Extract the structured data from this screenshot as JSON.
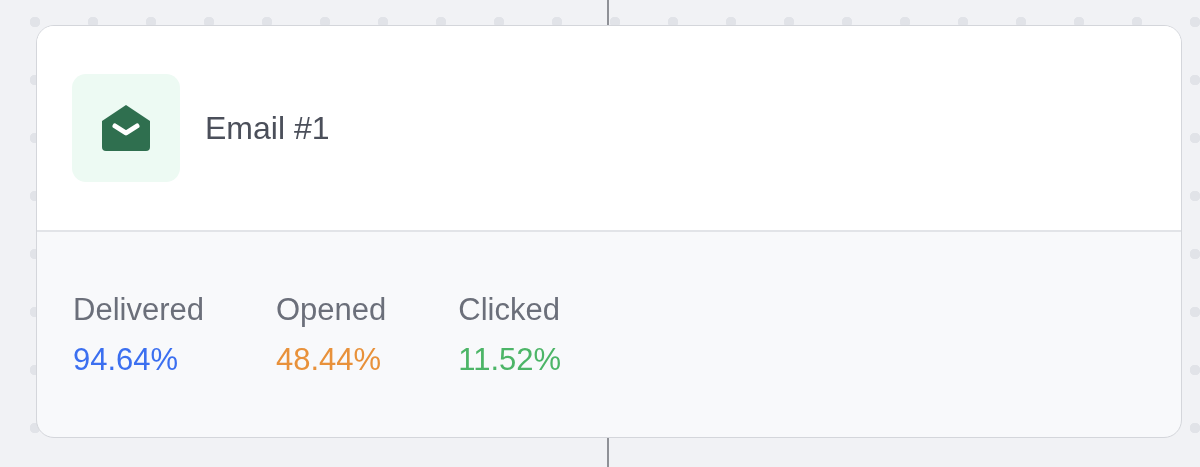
{
  "card": {
    "title": "Email #1",
    "stats": [
      {
        "label": "Delivered",
        "value": "94.64%",
        "color": "#3b6ff0"
      },
      {
        "label": "Opened",
        "value": "48.44%",
        "color": "#e8913a"
      },
      {
        "label": "Clicked",
        "value": "11.52%",
        "color": "#4cb567"
      }
    ]
  }
}
